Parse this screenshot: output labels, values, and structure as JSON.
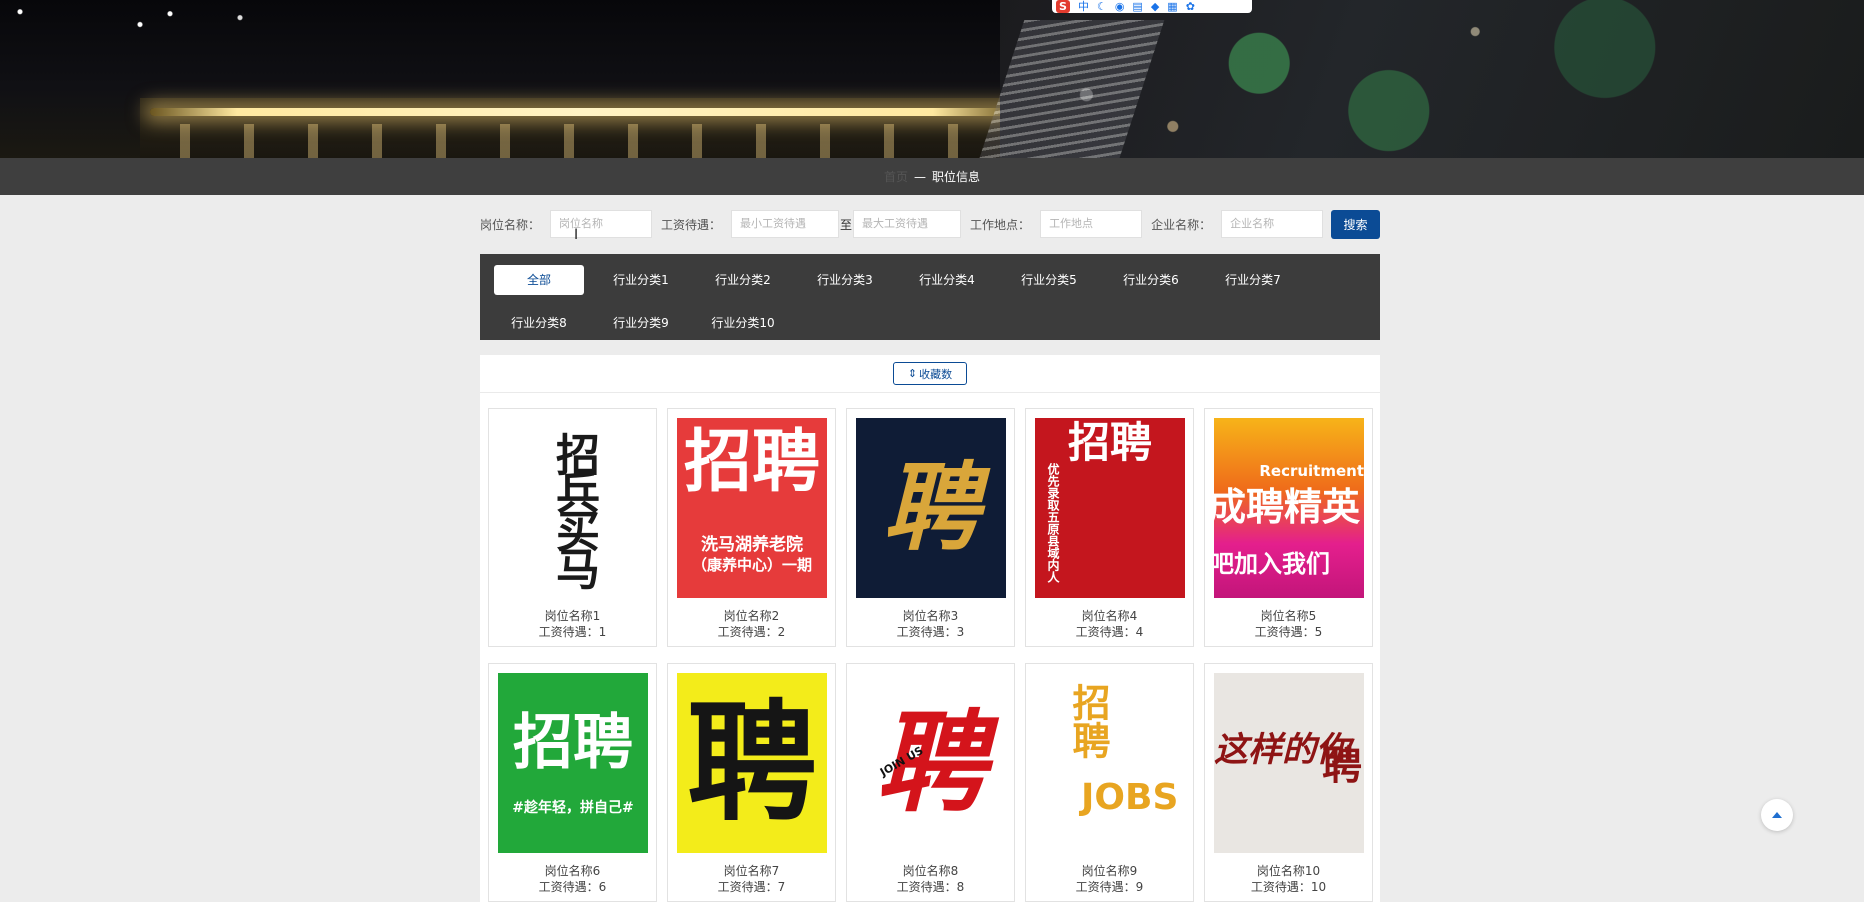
{
  "toolbar": {
    "items": [
      {
        "icon": "s-logo-icon",
        "label": "S"
      },
      {
        "icon": "chinese-input-icon",
        "label": "中"
      },
      {
        "icon": "moon-icon",
        "label": "☾"
      },
      {
        "icon": "mic-icon",
        "label": "◉"
      },
      {
        "icon": "keyboard-icon",
        "label": "▤"
      },
      {
        "icon": "skin-icon",
        "label": "◆"
      },
      {
        "icon": "grid-icon",
        "label": "▦"
      },
      {
        "icon": "settings-icon",
        "label": "✿"
      }
    ]
  },
  "breadcrumb": {
    "home": "首页",
    "separator": "—",
    "current": "职位信息"
  },
  "search": {
    "job_name_label": "岗位名称：",
    "job_name_placeholder": "岗位名称",
    "salary_label": "工资待遇：",
    "salary_min_placeholder": "最小工资待遇",
    "salary_to": "至",
    "salary_max_placeholder": "最大工资待遇",
    "location_label": "工作地点：",
    "location_placeholder": "工作地点",
    "company_label": "企业名称：",
    "company_placeholder": "企业名称",
    "search_button": "搜索"
  },
  "categories": {
    "row1": [
      "全部",
      "行业分类1",
      "行业分类2",
      "行业分类3",
      "行业分类4",
      "行业分类5",
      "行业分类6",
      "行业分类7"
    ],
    "row2": [
      "行业分类8",
      "行业分类9",
      "行业分类10"
    ]
  },
  "sort": {
    "label": "收藏数",
    "icon": "sort-icon"
  },
  "jobs": [
    {
      "name": "岗位名称1",
      "salary": "工资待遇：1",
      "art": "招兵买马"
    },
    {
      "name": "岗位名称2",
      "salary": "工资待遇：2",
      "art": "招聘",
      "sub": "洗马湖养老院",
      "sub2": "（康养中心）一期"
    },
    {
      "name": "岗位名称3",
      "salary": "工资待遇：3",
      "art": "聘"
    },
    {
      "name": "岗位名称4",
      "salary": "工资待遇：4",
      "art": "招聘",
      "sub": "优先录取五原县域内人"
    },
    {
      "name": "岗位名称5",
      "salary": "工资待遇：5",
      "art": "成聘精英",
      "sub": "Recruitment",
      "sub2": "吧加入我们"
    },
    {
      "name": "岗位名称6",
      "salary": "工资待遇：6",
      "art": "招聘",
      "sub": "#趁年轻，拼自己#"
    },
    {
      "name": "岗位名称7",
      "salary": "工资待遇：7",
      "art": "聘"
    },
    {
      "name": "岗位名称8",
      "salary": "工资待遇：8",
      "art": "聘",
      "sub": "JOIN US"
    },
    {
      "name": "岗位名称9",
      "salary": "工资待遇：9",
      "art": "招聘",
      "sub": "JOBS"
    },
    {
      "name": "岗位名称10",
      "salary": "工资待遇：10",
      "art": "这样的你",
      "sub": "聘"
    }
  ],
  "colors": {
    "accent": "#0b4b95",
    "crumb_bg": "#3f3f3f",
    "category_bg": "#3c3c3c"
  }
}
